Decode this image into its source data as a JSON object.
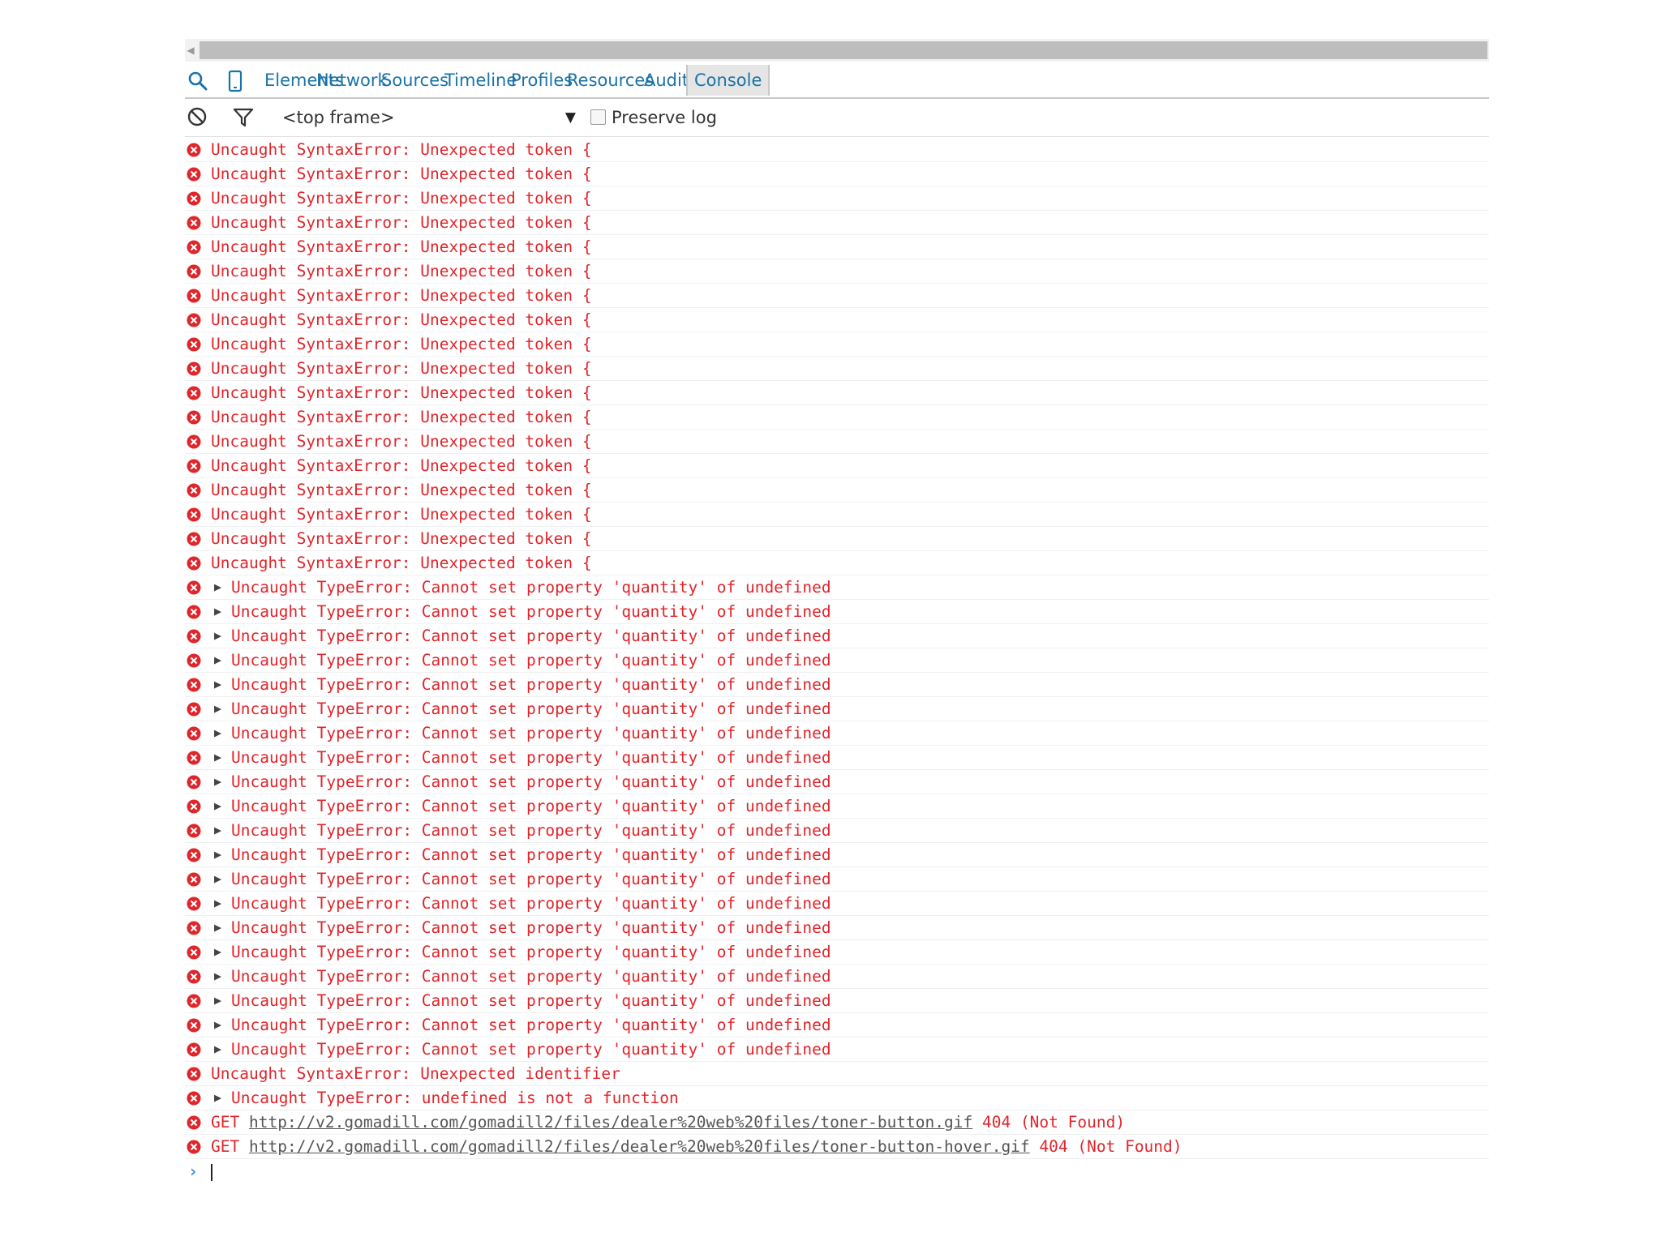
{
  "toolbar": {
    "icons": [
      "search-icon",
      "device-mode-icon"
    ],
    "tabs": [
      {
        "label": "Elements",
        "active": false
      },
      {
        "label": "Network",
        "active": false
      },
      {
        "label": "Sources",
        "active": false
      },
      {
        "label": "Timeline",
        "active": false
      },
      {
        "label": "Profiles",
        "active": false
      },
      {
        "label": "Resources",
        "active": false
      },
      {
        "label": "Audits",
        "active": false
      },
      {
        "label": "Console",
        "active": true
      }
    ]
  },
  "filter": {
    "icons": [
      "clear-console-icon",
      "filter-icon"
    ],
    "frame": "<top frame>",
    "frame_arrow": "▼",
    "preserve_log_label": "Preserve log",
    "preserve_log_checked": false
  },
  "console": {
    "messages": [
      {
        "text": "Uncaught SyntaxError: Unexpected token {",
        "expandable": false
      },
      {
        "text": "Uncaught SyntaxError: Unexpected token {",
        "expandable": false
      },
      {
        "text": "Uncaught SyntaxError: Unexpected token {",
        "expandable": false
      },
      {
        "text": "Uncaught SyntaxError: Unexpected token {",
        "expandable": false
      },
      {
        "text": "Uncaught SyntaxError: Unexpected token {",
        "expandable": false
      },
      {
        "text": "Uncaught SyntaxError: Unexpected token {",
        "expandable": false
      },
      {
        "text": "Uncaught SyntaxError: Unexpected token {",
        "expandable": false
      },
      {
        "text": "Uncaught SyntaxError: Unexpected token {",
        "expandable": false
      },
      {
        "text": "Uncaught SyntaxError: Unexpected token {",
        "expandable": false
      },
      {
        "text": "Uncaught SyntaxError: Unexpected token {",
        "expandable": false
      },
      {
        "text": "Uncaught SyntaxError: Unexpected token {",
        "expandable": false
      },
      {
        "text": "Uncaught SyntaxError: Unexpected token {",
        "expandable": false
      },
      {
        "text": "Uncaught SyntaxError: Unexpected token {",
        "expandable": false
      },
      {
        "text": "Uncaught SyntaxError: Unexpected token {",
        "expandable": false
      },
      {
        "text": "Uncaught SyntaxError: Unexpected token {",
        "expandable": false
      },
      {
        "text": "Uncaught SyntaxError: Unexpected token {",
        "expandable": false
      },
      {
        "text": "Uncaught SyntaxError: Unexpected token {",
        "expandable": false
      },
      {
        "text": "Uncaught SyntaxError: Unexpected token {",
        "expandable": false
      },
      {
        "text": "Uncaught TypeError: Cannot set property 'quantity' of undefined",
        "expandable": true
      },
      {
        "text": "Uncaught TypeError: Cannot set property 'quantity' of undefined",
        "expandable": true
      },
      {
        "text": "Uncaught TypeError: Cannot set property 'quantity' of undefined",
        "expandable": true
      },
      {
        "text": "Uncaught TypeError: Cannot set property 'quantity' of undefined",
        "expandable": true
      },
      {
        "text": "Uncaught TypeError: Cannot set property 'quantity' of undefined",
        "expandable": true
      },
      {
        "text": "Uncaught TypeError: Cannot set property 'quantity' of undefined",
        "expandable": true
      },
      {
        "text": "Uncaught TypeError: Cannot set property 'quantity' of undefined",
        "expandable": true
      },
      {
        "text": "Uncaught TypeError: Cannot set property 'quantity' of undefined",
        "expandable": true
      },
      {
        "text": "Uncaught TypeError: Cannot set property 'quantity' of undefined",
        "expandable": true
      },
      {
        "text": "Uncaught TypeError: Cannot set property 'quantity' of undefined",
        "expandable": true
      },
      {
        "text": "Uncaught TypeError: Cannot set property 'quantity' of undefined",
        "expandable": true
      },
      {
        "text": "Uncaught TypeError: Cannot set property 'quantity' of undefined",
        "expandable": true
      },
      {
        "text": "Uncaught TypeError: Cannot set property 'quantity' of undefined",
        "expandable": true
      },
      {
        "text": "Uncaught TypeError: Cannot set property 'quantity' of undefined",
        "expandable": true
      },
      {
        "text": "Uncaught TypeError: Cannot set property 'quantity' of undefined",
        "expandable": true
      },
      {
        "text": "Uncaught TypeError: Cannot set property 'quantity' of undefined",
        "expandable": true
      },
      {
        "text": "Uncaught TypeError: Cannot set property 'quantity' of undefined",
        "expandable": true
      },
      {
        "text": "Uncaught TypeError: Cannot set property 'quantity' of undefined",
        "expandable": true
      },
      {
        "text": "Uncaught TypeError: Cannot set property 'quantity' of undefined",
        "expandable": true
      },
      {
        "text": "Uncaught TypeError: Cannot set property 'quantity' of undefined",
        "expandable": true
      },
      {
        "text": "Uncaught SyntaxError: Unexpected identifier",
        "expandable": false
      },
      {
        "text": "Uncaught TypeError: undefined is not a function",
        "expandable": true
      },
      {
        "method": "GET",
        "url": "http://v2.gomadill.com/gomadill2/files/dealer%20web%20files/toner-button.gif",
        "status": "404 (Not Found)",
        "expandable": false
      },
      {
        "method": "GET",
        "url": "http://v2.gomadill.com/gomadill2/files/dealer%20web%20files/toner-button-hover.gif",
        "status": "404 (Not Found)",
        "expandable": false
      }
    ],
    "colors": {
      "error": "#e0252b",
      "tab_text": "#1a73a8",
      "prompt": "#3a8ed6"
    }
  }
}
